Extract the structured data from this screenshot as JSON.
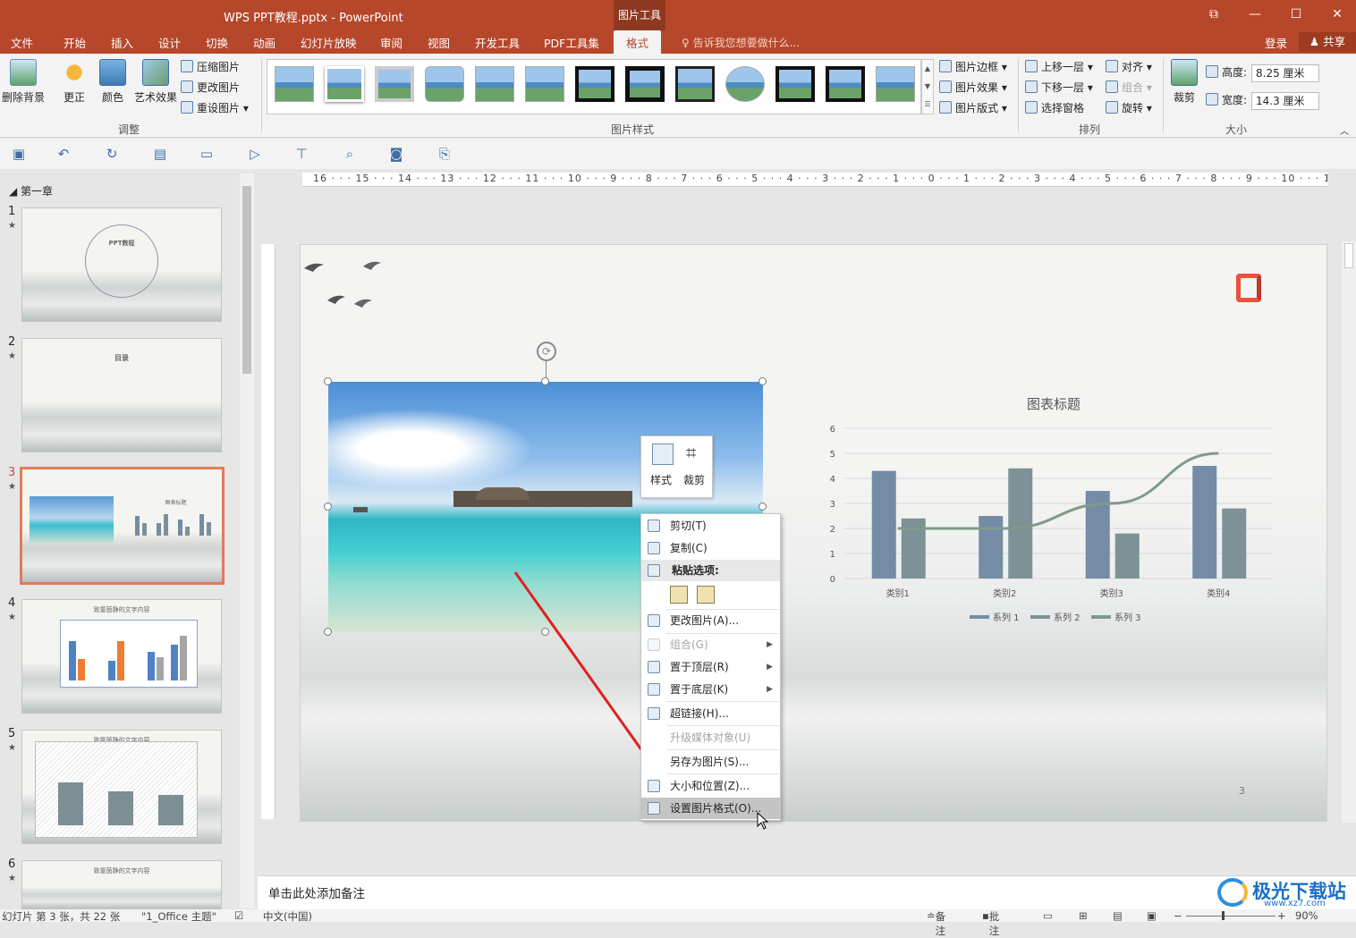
{
  "window": {
    "title": "WPS PPT教程.pptx - PowerPoint",
    "context_tab_group": "图片工具"
  },
  "tabs": [
    "文件",
    "开始",
    "插入",
    "设计",
    "切换",
    "动画",
    "幻灯片放映",
    "审阅",
    "视图",
    "开发工具",
    "PDF工具集",
    "格式"
  ],
  "active_tab": "格式",
  "tell_me": "告诉我您想要做什么...",
  "account": {
    "login": "登录",
    "share": "共享"
  },
  "ribbon": {
    "adjust": {
      "remove_bg": "删除背景",
      "correct": "更正",
      "color": "颜色",
      "artistic": "艺术效果",
      "compress": "压缩图片",
      "change": "更改图片",
      "reset": "重设图片",
      "label": "调整"
    },
    "styles": {
      "border": "图片边框",
      "effects": "图片效果",
      "layout": "图片版式",
      "label": "图片样式"
    },
    "arrange": {
      "forward": "上移一层",
      "backward": "下移一层",
      "pane": "选择窗格",
      "align": "对齐",
      "group": "组合",
      "rotate": "旋转",
      "label": "排列"
    },
    "size": {
      "crop": "裁剪",
      "height_label": "高度:",
      "height": "8.25 厘米",
      "width_label": "宽度:",
      "width": "14.3 厘米",
      "label": "大小"
    }
  },
  "ruler": {
    "h": "16 · · · 15 · · · 14 · · · 13 · · · 12 · · · 11 · · · 10 · · · 9 · · · 8 · · · 7 · · · 6 · · · 5 · · · 4 · · · 3 · · · 2 · · · 1 · · · 0 · · · 1 · · · 2 · · · 3 · · · 4 · · · 5 · · · 6 · · · 7 · · · 8 · · · 9 · · · 10 · · · 11 · · · 12 · · · 13 · · · 14 · · · 15 · · · 16"
  },
  "slides_panel": {
    "section": "第一章",
    "slides": [
      {
        "num": "1",
        "text": "PPT教程"
      },
      {
        "num": "2",
        "text": "目录"
      },
      {
        "num": "3",
        "text": "图表标题"
      },
      {
        "num": "4",
        "text": "致童茵静的文字内容"
      },
      {
        "num": "5",
        "text": "致童茵静的文字内容"
      },
      {
        "num": "6",
        "text": "致童茵静的文字内容"
      }
    ]
  },
  "mini_toolbar": {
    "style": "样式",
    "crop": "裁剪"
  },
  "context_menu": [
    {
      "label": "剪切(T)",
      "state": "normal"
    },
    {
      "label": "复制(C)",
      "state": "normal"
    },
    {
      "label": "粘贴选项:",
      "state": "header"
    },
    {
      "label": "更改图片(A)...",
      "state": "normal"
    },
    {
      "label": "组合(G)",
      "state": "disabled",
      "submenu": true
    },
    {
      "label": "置于顶层(R)",
      "state": "normal",
      "submenu": true
    },
    {
      "label": "置于底层(K)",
      "state": "normal",
      "submenu": true
    },
    {
      "label": "超链接(H)...",
      "state": "normal"
    },
    {
      "label": "升级媒体对象(U)",
      "state": "disabled"
    },
    {
      "label": "另存为图片(S)...",
      "state": "normal"
    },
    {
      "label": "大小和位置(Z)...",
      "state": "normal"
    },
    {
      "label": "设置图片格式(O)...",
      "state": "highlighted"
    }
  ],
  "slide_number": "3",
  "notes_placeholder": "单击此处添加备注",
  "status": {
    "slide_info": "幻灯片 第 3 张，共 22 张",
    "theme": "\"1_Office 主题\"",
    "language": "中文(中国)",
    "notes": "备注",
    "comments": "批注",
    "zoom": "90%"
  },
  "watermark": {
    "name": "极光下载站",
    "url": "www.xz7.com"
  },
  "colors": {
    "accent": "#b7472a",
    "series1": "#748ca5",
    "series2": "#7d9296",
    "series3": "#7f9a8a"
  },
  "chart_data": {
    "type": "bar",
    "title": "图表标题",
    "categories": [
      "类别1",
      "类别2",
      "类别3",
      "类别4"
    ],
    "series": [
      {
        "name": "系列 1",
        "type": "bar",
        "values": [
          4.3,
          2.5,
          3.5,
          4.5
        ]
      },
      {
        "name": "系列 2",
        "type": "bar",
        "values": [
          2.4,
          4.4,
          1.8,
          2.8
        ]
      },
      {
        "name": "系列 3",
        "type": "line",
        "values": [
          2,
          2,
          3,
          5
        ]
      }
    ],
    "ylim": [
      0,
      6
    ],
    "yticks": [
      "0",
      "1",
      "2",
      "3",
      "4",
      "5",
      "6"
    ],
    "legend": "bottom",
    "grid": true
  }
}
